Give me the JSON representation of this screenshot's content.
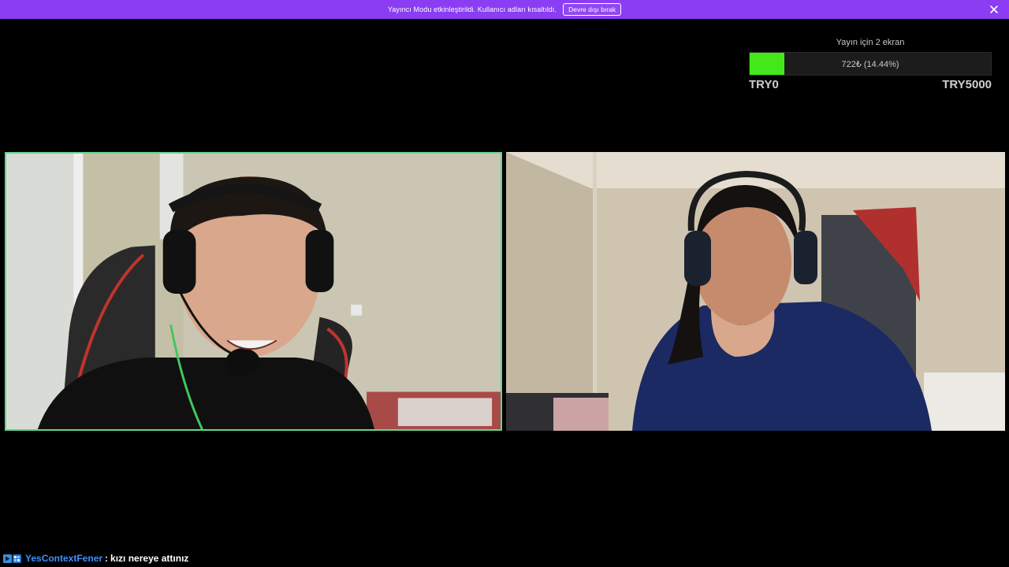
{
  "banner": {
    "message": "Yayıncı Modu etkinleştirildi. Kullanıcı adları kısaltıldı.",
    "button_label": "Devre dışı bırak",
    "close_icon": "close-icon",
    "color": "#8a3df2"
  },
  "goal": {
    "title": "Yayın için 2 ekran",
    "amount_text": "722₺ (14.44%)",
    "progress_fraction": 0.1444,
    "min_label": "TRY0",
    "max_label": "TRY5000",
    "fill_color": "#44e81a"
  },
  "cams": {
    "left_border_color": "#63d68f"
  },
  "chat": {
    "badges": [
      "prime-badge-icon",
      "sub-badge-icon"
    ],
    "username": "YesContextFener",
    "separator": ":",
    "message": "kızı nereye attınız",
    "username_color": "#3d8fff"
  }
}
